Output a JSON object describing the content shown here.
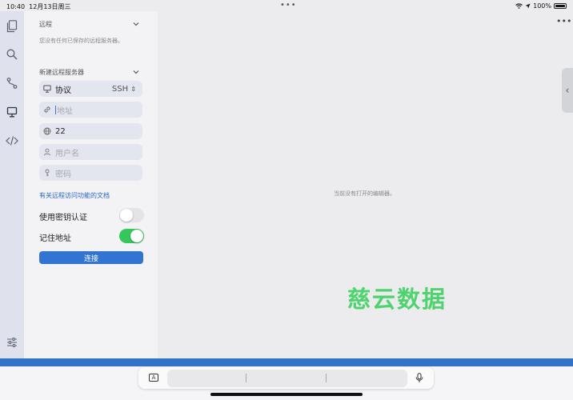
{
  "status_bar": {
    "time": "10:40",
    "date": "12月13日周三",
    "battery": "100%",
    "icons": [
      "wifi-icon",
      "location-icon",
      "battery-icon"
    ]
  },
  "activity_bar": {
    "icons": [
      "files-icon",
      "search-icon",
      "source-control-icon",
      "remote-explorer-icon",
      "code-icon",
      "settings-sliders-icon"
    ]
  },
  "remote_section": {
    "title": "远程",
    "empty_hint": "您没有任何已保存的远程服务器。"
  },
  "new_server": {
    "title": "新建远程服务器",
    "protocol": {
      "label": "协议",
      "value": "SSH"
    },
    "address": {
      "placeholder": "地址"
    },
    "port": {
      "value": "22"
    },
    "username": {
      "placeholder": "用户名"
    },
    "password": {
      "placeholder": "密码"
    },
    "doc_link": "有关远程访问功能的文档",
    "use_key_auth": {
      "label": "使用密钥认证",
      "on": false
    },
    "remember_address": {
      "label": "记住地址",
      "on": true
    },
    "connect_label": "连接"
  },
  "editor": {
    "empty_message": "当前没有打开的编辑器。"
  },
  "watermark": "慈云数据",
  "keyboard_bar": {
    "icons": [
      "keyboard-a-icon",
      "mic-icon"
    ]
  },
  "colors": {
    "accent": "#3174d1",
    "toggle_on": "#34c759",
    "toggle_off": "#e4e4e8",
    "watermark": "#4ed36e"
  }
}
